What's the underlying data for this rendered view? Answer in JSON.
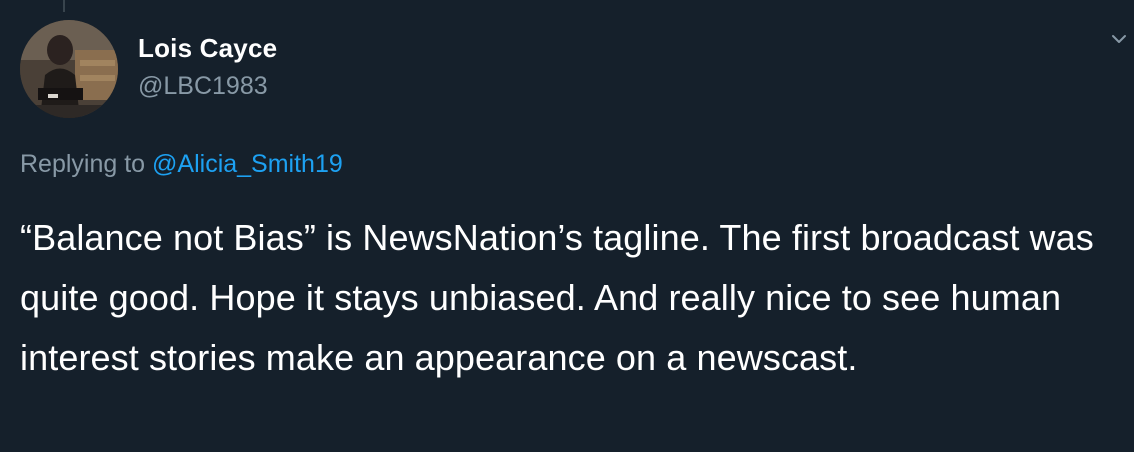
{
  "author": {
    "display_name": "Lois Cayce",
    "handle": "@LBC1983",
    "avatar_icon": "profile-photo"
  },
  "reply": {
    "prefix": "Replying to ",
    "mention": "@Alicia_Smith19"
  },
  "tweet": {
    "text": "“Balance not Bias” is NewsNation’s tagline. The first broadcast was quite good. Hope it stays unbiased. And really nice to see human interest stories make an appearance on a newscast."
  },
  "menu": {
    "icon": "chevron-down-icon"
  },
  "colors": {
    "background": "#15202b",
    "primary_text": "#ffffff",
    "secondary_text": "#8899a6",
    "link": "#1da1f2"
  }
}
